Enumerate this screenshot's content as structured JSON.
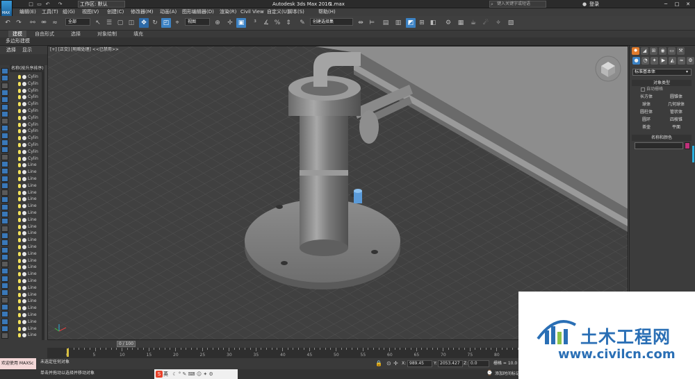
{
  "app": {
    "logo_text": "MAX",
    "workspace": "工作区: 默认",
    "title": "Autodesk 3ds Max 2016",
    "filename": "1.max",
    "search_placeholder": "键入关键字或短语",
    "login": "登录"
  },
  "menu": [
    "编辑(E)",
    "工具(T)",
    "组(G)",
    "视图(V)",
    "创建(C)",
    "修改器(M)",
    "动画(A)",
    "图形编辑器(D)",
    "渲染(R)",
    "Civil View",
    "自定义(U)",
    "脚本(S)",
    "帮助(H)"
  ],
  "toolbar": {
    "filter_dd": "全部",
    "refcoord_dd": "视图",
    "selset_dd": "创建选择集"
  },
  "ribbon": {
    "tabs": [
      "建模",
      "自由形式",
      "选择",
      "对象绘制",
      "填充"
    ],
    "active": 0,
    "sub": "多边形建模"
  },
  "explorer": {
    "tabs": [
      "选择",
      "显示"
    ],
    "header": "名称(按升序排序)",
    "items": [
      "Cylin",
      "Cylin",
      "Cylin",
      "Cylin",
      "Cylin",
      "Cylin",
      "Cylin",
      "Cylin",
      "Cylin",
      "Cylin",
      "Cylin",
      "Cylin",
      "Cylin",
      "Line",
      "Line",
      "Line",
      "Line",
      "Line",
      "Line",
      "Line",
      "Line",
      "Line",
      "Line",
      "Line",
      "Line",
      "Line",
      "Line",
      "Line",
      "Line",
      "Line",
      "Line",
      "Line",
      "Line",
      "Line",
      "Line",
      "Line",
      "Line",
      "Line",
      "Line"
    ]
  },
  "viewport": {
    "label": "[+] [正交] [明暗处理] <<已禁用>>"
  },
  "command_panel": {
    "dropdown": "标准基本体",
    "object_type_header": "对象类型",
    "autogrid": "自动栅格",
    "buttons": [
      "长方体",
      "圆锥体",
      "球体",
      "几何球体",
      "圆柱体",
      "管状体",
      "圆环",
      "四棱锥",
      "茶壶",
      "平面"
    ],
    "name_color_header": "名称和颜色"
  },
  "timeline": {
    "slider": "0 / 100",
    "ticks": [
      0,
      5,
      10,
      15,
      20,
      25,
      30,
      35,
      40,
      45,
      50,
      55,
      60,
      65,
      70,
      75,
      80
    ]
  },
  "status": {
    "welcome": "欢迎使用 MAXSc",
    "line1": "未选定任何对象",
    "line2": "单击并拖动以选择并移动对象",
    "x_label": "X:",
    "x_value": "989.45",
    "y_label": "Y:",
    "y_value": "2053.427",
    "z_label": "Z:",
    "z_value": "0.0",
    "grid": "栅格 = 10.0",
    "addkey": "添加时间标记"
  },
  "ime": {
    "label": "英"
  },
  "watermark": {
    "title": "土木工程网",
    "url": "www.civilcn.com"
  },
  "colors": {
    "accent": "#3c82c4",
    "active_tab": "#e07a2b",
    "object_color": "#c0307a",
    "brand": "#2a6fb5"
  }
}
